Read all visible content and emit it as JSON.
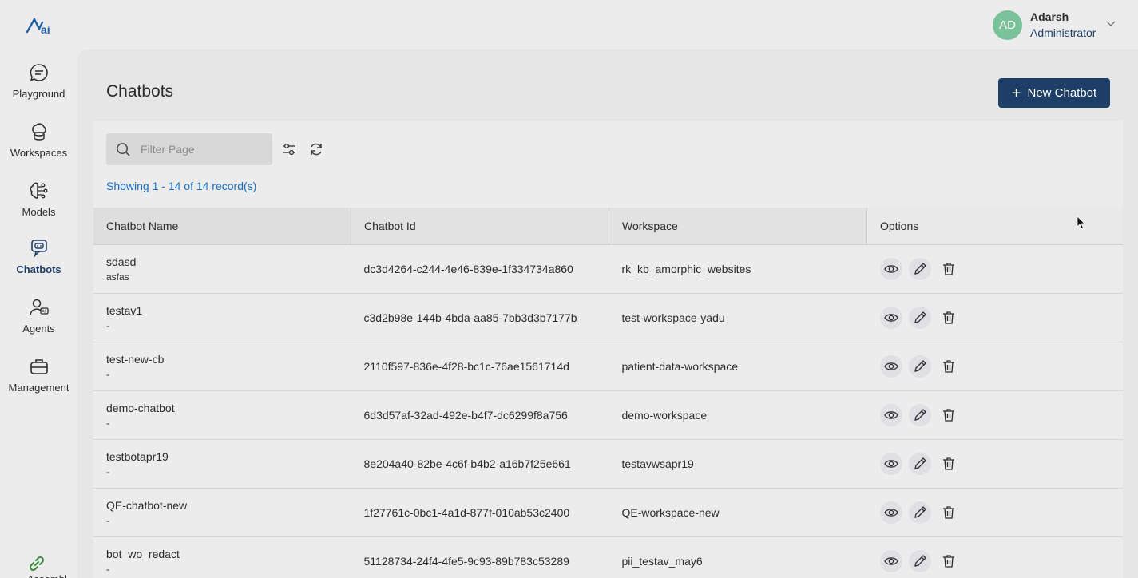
{
  "nav": {
    "items": [
      {
        "label": "Playground",
        "icon": "chat-bubble-icon"
      },
      {
        "label": "Workspaces",
        "icon": "cloud-database-icon"
      },
      {
        "label": "Models",
        "icon": "brain-icon"
      },
      {
        "label": "Chatbots",
        "icon": "chatbot-icon"
      },
      {
        "label": "Agents",
        "icon": "agent-icon"
      },
      {
        "label": "Management",
        "icon": "briefcase-icon"
      }
    ],
    "bottom_label": "Assembly"
  },
  "user": {
    "initials": "AD",
    "name": "Adarsh",
    "role": "Administrator"
  },
  "page": {
    "title": "Chatbots",
    "new_button": "New Chatbot"
  },
  "filter": {
    "placeholder": "Filter Page"
  },
  "records_text": "Showing 1 - 14 of 14 record(s)",
  "table": {
    "columns": [
      "Chatbot Name",
      "Chatbot Id",
      "Workspace",
      "Options"
    ],
    "rows": [
      {
        "name": "sdasd",
        "desc": "asfas",
        "id": "dc3d4264-c244-4e46-839e-1f334734a860",
        "workspace": "rk_kb_amorphic_websites"
      },
      {
        "name": "testav1",
        "desc": "-",
        "id": "c3d2b98e-144b-4bda-aa85-7bb3d3b7177b",
        "workspace": "test-workspace-yadu"
      },
      {
        "name": "test-new-cb",
        "desc": "-",
        "id": "2110f597-836e-4f28-bc1c-76ae1561714d",
        "workspace": "patient-data-workspace"
      },
      {
        "name": "demo-chatbot",
        "desc": "-",
        "id": "6d3d57af-32ad-492e-b4f7-dc6299f8a756",
        "workspace": "demo-workspace"
      },
      {
        "name": "testbotapr19",
        "desc": "-",
        "id": "8e204a40-82be-4c6f-b4b2-a16b7f25e661",
        "workspace": "testavwsapr19"
      },
      {
        "name": "QE-chatbot-new",
        "desc": "-",
        "id": "1f27761c-0bc1-4a1d-877f-010ab53c2400",
        "workspace": "QE-workspace-new"
      },
      {
        "name": "bot_wo_redact",
        "desc": "-",
        "id": "51128734-24f4-4fe5-9c93-89b783c53289",
        "workspace": "pii_testav_may6"
      }
    ]
  },
  "colors": {
    "accent": "#1d3e66",
    "link": "#1a6fc0",
    "avatar": "#7ac29a"
  }
}
